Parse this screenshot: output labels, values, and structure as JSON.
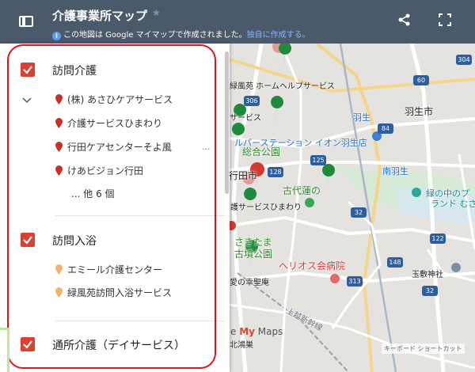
{
  "header": {
    "title": "介護事業所マップ",
    "subtitle": "この地図は Google マイマップで作成されました。",
    "subtitle_link": "独自に作成する。",
    "info_glyph": "i"
  },
  "layers": [
    {
      "title": "訪問介護",
      "checked": true,
      "items": [
        {
          "label": "(株) あさひケアサービス",
          "pin_color": "#c9302c"
        },
        {
          "label": "介護サービスひまわり",
          "pin_color": "#c9302c"
        },
        {
          "label": "行田ケアセンターそよ風",
          "pin_color": "#c9302c"
        },
        {
          "label": "けあビジョン行田",
          "pin_color": "#c9302c"
        }
      ],
      "more": "... 他 6 個",
      "row_menu": "..."
    },
    {
      "title": "訪問入浴",
      "checked": true,
      "items": [
        {
          "label": "エミール介護センター",
          "pin_color": "#f0b56a"
        },
        {
          "label": "緑風苑訪問入浴サービス",
          "pin_color": "#f0b56a"
        }
      ]
    },
    {
      "title": "通所介護（デイサービス）",
      "checked": true
    }
  ],
  "map": {
    "labels": {
      "home_helper": "緑風苑 ホームヘルプサービス",
      "hanyu_shi": "羽生市",
      "hanyu_station": "羽生",
      "service": "サービス",
      "aeon": "ルパーステーション イオン羽生店",
      "sogo_park": "総合公園",
      "gyoda_shi": "行田市",
      "minami_hanyu": "南羽生",
      "kodai_hasu": "古代蓮の",
      "himawari": "護サービスひまわり",
      "midori_no": "緑の中のプ",
      "land": "ランド むさ",
      "sakitama": "さきたま",
      "kofun": "古墳公園",
      "helios": "ヘリオス会病院",
      "tamashiki": "玉敷神社",
      "koufukuen": "愛の幸聖庵",
      "joetsu": "上越新幹線",
      "kounosu": "北鴻巣"
    },
    "route_numbers": {
      "r304": "304",
      "r306": "306",
      "r60": "60",
      "r84": "84",
      "r125": "125",
      "r128": "128",
      "r32a": "32",
      "r32b": "32",
      "r122": "122",
      "r148": "148",
      "r313": "313"
    },
    "branding": {
      "my": "My",
      "maps": " Maps",
      "prefix": "e "
    },
    "keyboard_shortcuts": "キーボード ショートカット"
  },
  "colors": {
    "header_bg": "#4a5a6b",
    "checkbox": "#d94133",
    "pin_red": "#c9302c",
    "pin_green": "#1e8a3c",
    "pin_pink": "#e79a94",
    "pin_orange": "#f0b56a",
    "annotation_ring": "#e0141e"
  }
}
